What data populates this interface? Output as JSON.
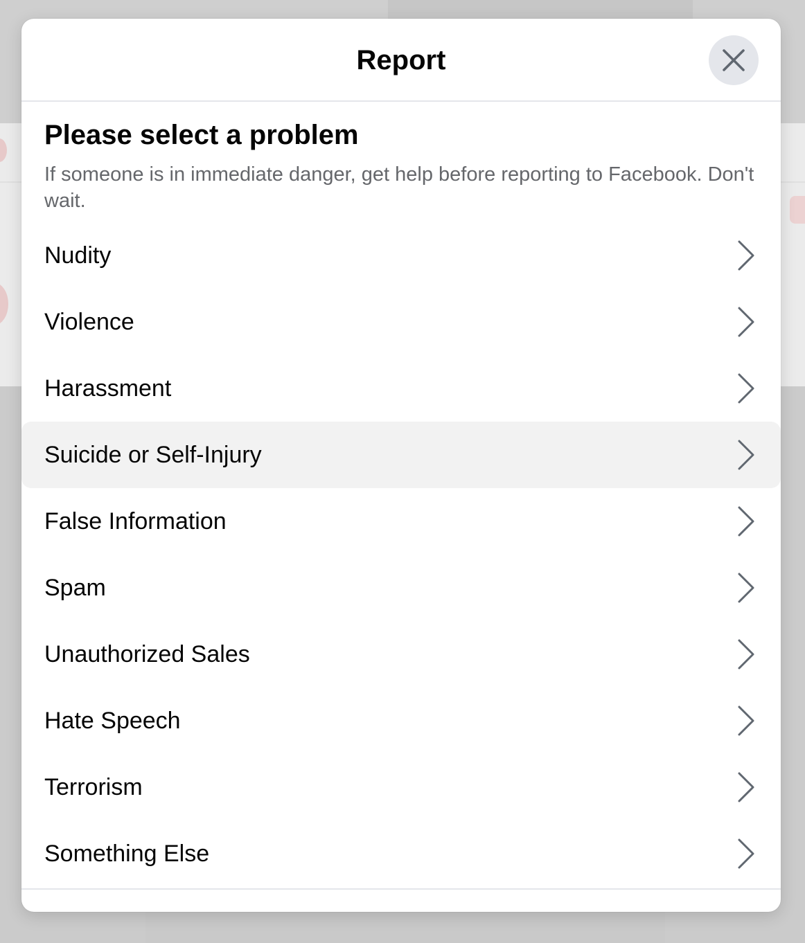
{
  "dialog": {
    "title": "Report",
    "close_icon": "close-icon"
  },
  "content": {
    "heading": "Please select a problem",
    "subtext": "If someone is in immediate danger, get help before reporting to Facebook. Don't wait."
  },
  "problems": [
    {
      "label": "Nudity",
      "highlighted": false
    },
    {
      "label": "Violence",
      "highlighted": false
    },
    {
      "label": "Harassment",
      "highlighted": false
    },
    {
      "label": "Suicide or Self-Injury",
      "highlighted": true
    },
    {
      "label": "False Information",
      "highlighted": false
    },
    {
      "label": "Spam",
      "highlighted": false
    },
    {
      "label": "Unauthorized Sales",
      "highlighted": false
    },
    {
      "label": "Hate Speech",
      "highlighted": false
    },
    {
      "label": "Terrorism",
      "highlighted": false
    },
    {
      "label": "Something Else",
      "highlighted": false
    }
  ],
  "colors": {
    "text_primary": "#050505",
    "text_secondary": "#65676b",
    "close_bg": "#e4e6eb",
    "hover_bg": "#f2f2f2",
    "chevron": "#606770"
  },
  "icons": {
    "row_chevron": "chevron-right-icon"
  }
}
